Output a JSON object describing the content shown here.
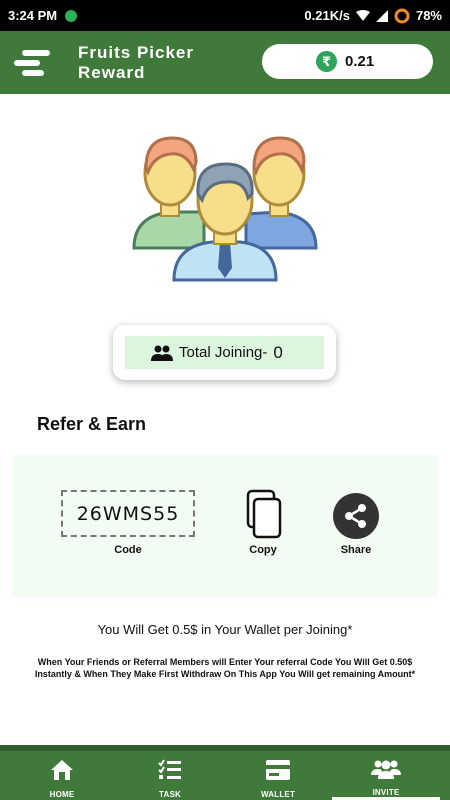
{
  "status_bar": {
    "time": "3:24 PM",
    "network_speed": "0.21K/s",
    "battery": "78%"
  },
  "app_bar": {
    "title": "Fruits Picker Reward",
    "balance": "0.21",
    "currency_icon": "₹"
  },
  "joining": {
    "label": "Total Joining-",
    "count": "0"
  },
  "refer": {
    "title": "Refer & Earn",
    "code": "26WMS55",
    "code_caption": "Code",
    "copy_caption": "Copy",
    "share_caption": "Share"
  },
  "notes": {
    "main": "You Will Get 0.5$ in Your Wallet per Joining*",
    "sub": "When Your Friends or Referral Members will Enter Your referral Code You Will Get 0.50$ Instantly & When They Make First Withdraw On This App You Will get remaining Amount*"
  },
  "bottom_nav": {
    "items": [
      {
        "label": "HOME",
        "icon": "home-icon"
      },
      {
        "label": "TASK",
        "icon": "task-list-icon"
      },
      {
        "label": "WALLET",
        "icon": "wallet-icon"
      },
      {
        "label": "INVITE",
        "icon": "group-icon"
      }
    ],
    "active": "INVITE"
  },
  "colors": {
    "primary": "#3f7a3b",
    "accent_green": "#2ea35a",
    "joining_bg": "#dcf5dc",
    "panel_bg": "#f3fcf3"
  }
}
